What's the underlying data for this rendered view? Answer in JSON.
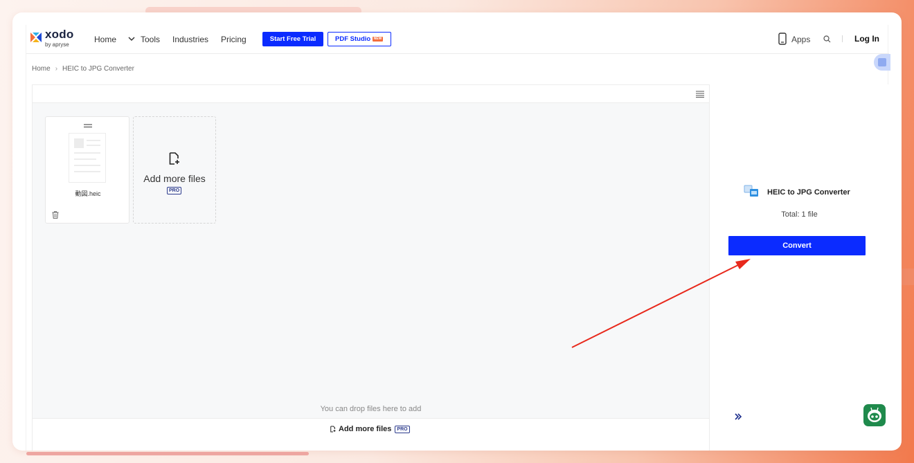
{
  "logo": {
    "name": "xodo",
    "sub": "by apryse"
  },
  "nav": {
    "home": "Home",
    "tools": "Tools",
    "industries": "Industries",
    "pricing": "Pricing"
  },
  "header_buttons": {
    "trial": "Start Free Trial",
    "studio": "PDF Studio",
    "studio_badge": "NEW"
  },
  "header_right": {
    "apps": "Apps",
    "login": "Log In"
  },
  "breadcrumb": {
    "home": "Home",
    "separator": "›",
    "current": "HEIC to JPG Converter"
  },
  "files": [
    {
      "name": "動図.heic"
    }
  ],
  "add_card": {
    "label": "Add more files",
    "badge": "PRO"
  },
  "workspace": {
    "drop_hint": "You can drop files here to add",
    "footer_add": "Add more files",
    "footer_badge": "PRO"
  },
  "panel": {
    "title": "HEIC to JPG Converter",
    "total": "Total: 1 file",
    "convert": "Convert"
  },
  "colors": {
    "brand_blue": "#0b2bff",
    "annotation_red": "#e8291c"
  }
}
